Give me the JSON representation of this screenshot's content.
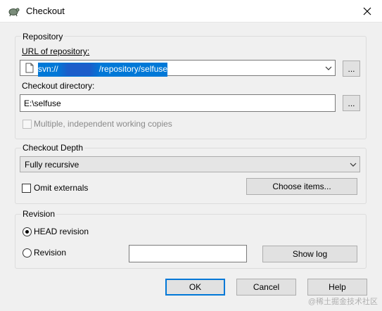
{
  "window": {
    "title": "Checkout",
    "app_icon": "tortoisesvn-icon",
    "close_icon": "close-icon"
  },
  "repository": {
    "group_label": "Repository",
    "url_label": "URL of repository:",
    "url_prefix": "svn://",
    "url_suffix": "/repository/selfuse",
    "browse_label": "...",
    "dir_label": "Checkout directory:",
    "dir_value": "E:\\selfuse",
    "dir_browse_label": "...",
    "multiple_label": "Multiple, independent working copies"
  },
  "depth": {
    "group_label": "Checkout Depth",
    "selected": "Fully recursive",
    "omit_label": "Omit externals",
    "choose_label": "Choose items..."
  },
  "revision": {
    "group_label": "Revision",
    "head_label": "HEAD revision",
    "rev_label": "Revision",
    "rev_value": "",
    "show_log_label": "Show log"
  },
  "buttons": {
    "ok": "OK",
    "cancel": "Cancel",
    "help": "Help"
  },
  "watermark": "@稀土掘金技术社区",
  "colors": {
    "accent": "#0078d7",
    "window_bg": "#f0f0f0"
  }
}
